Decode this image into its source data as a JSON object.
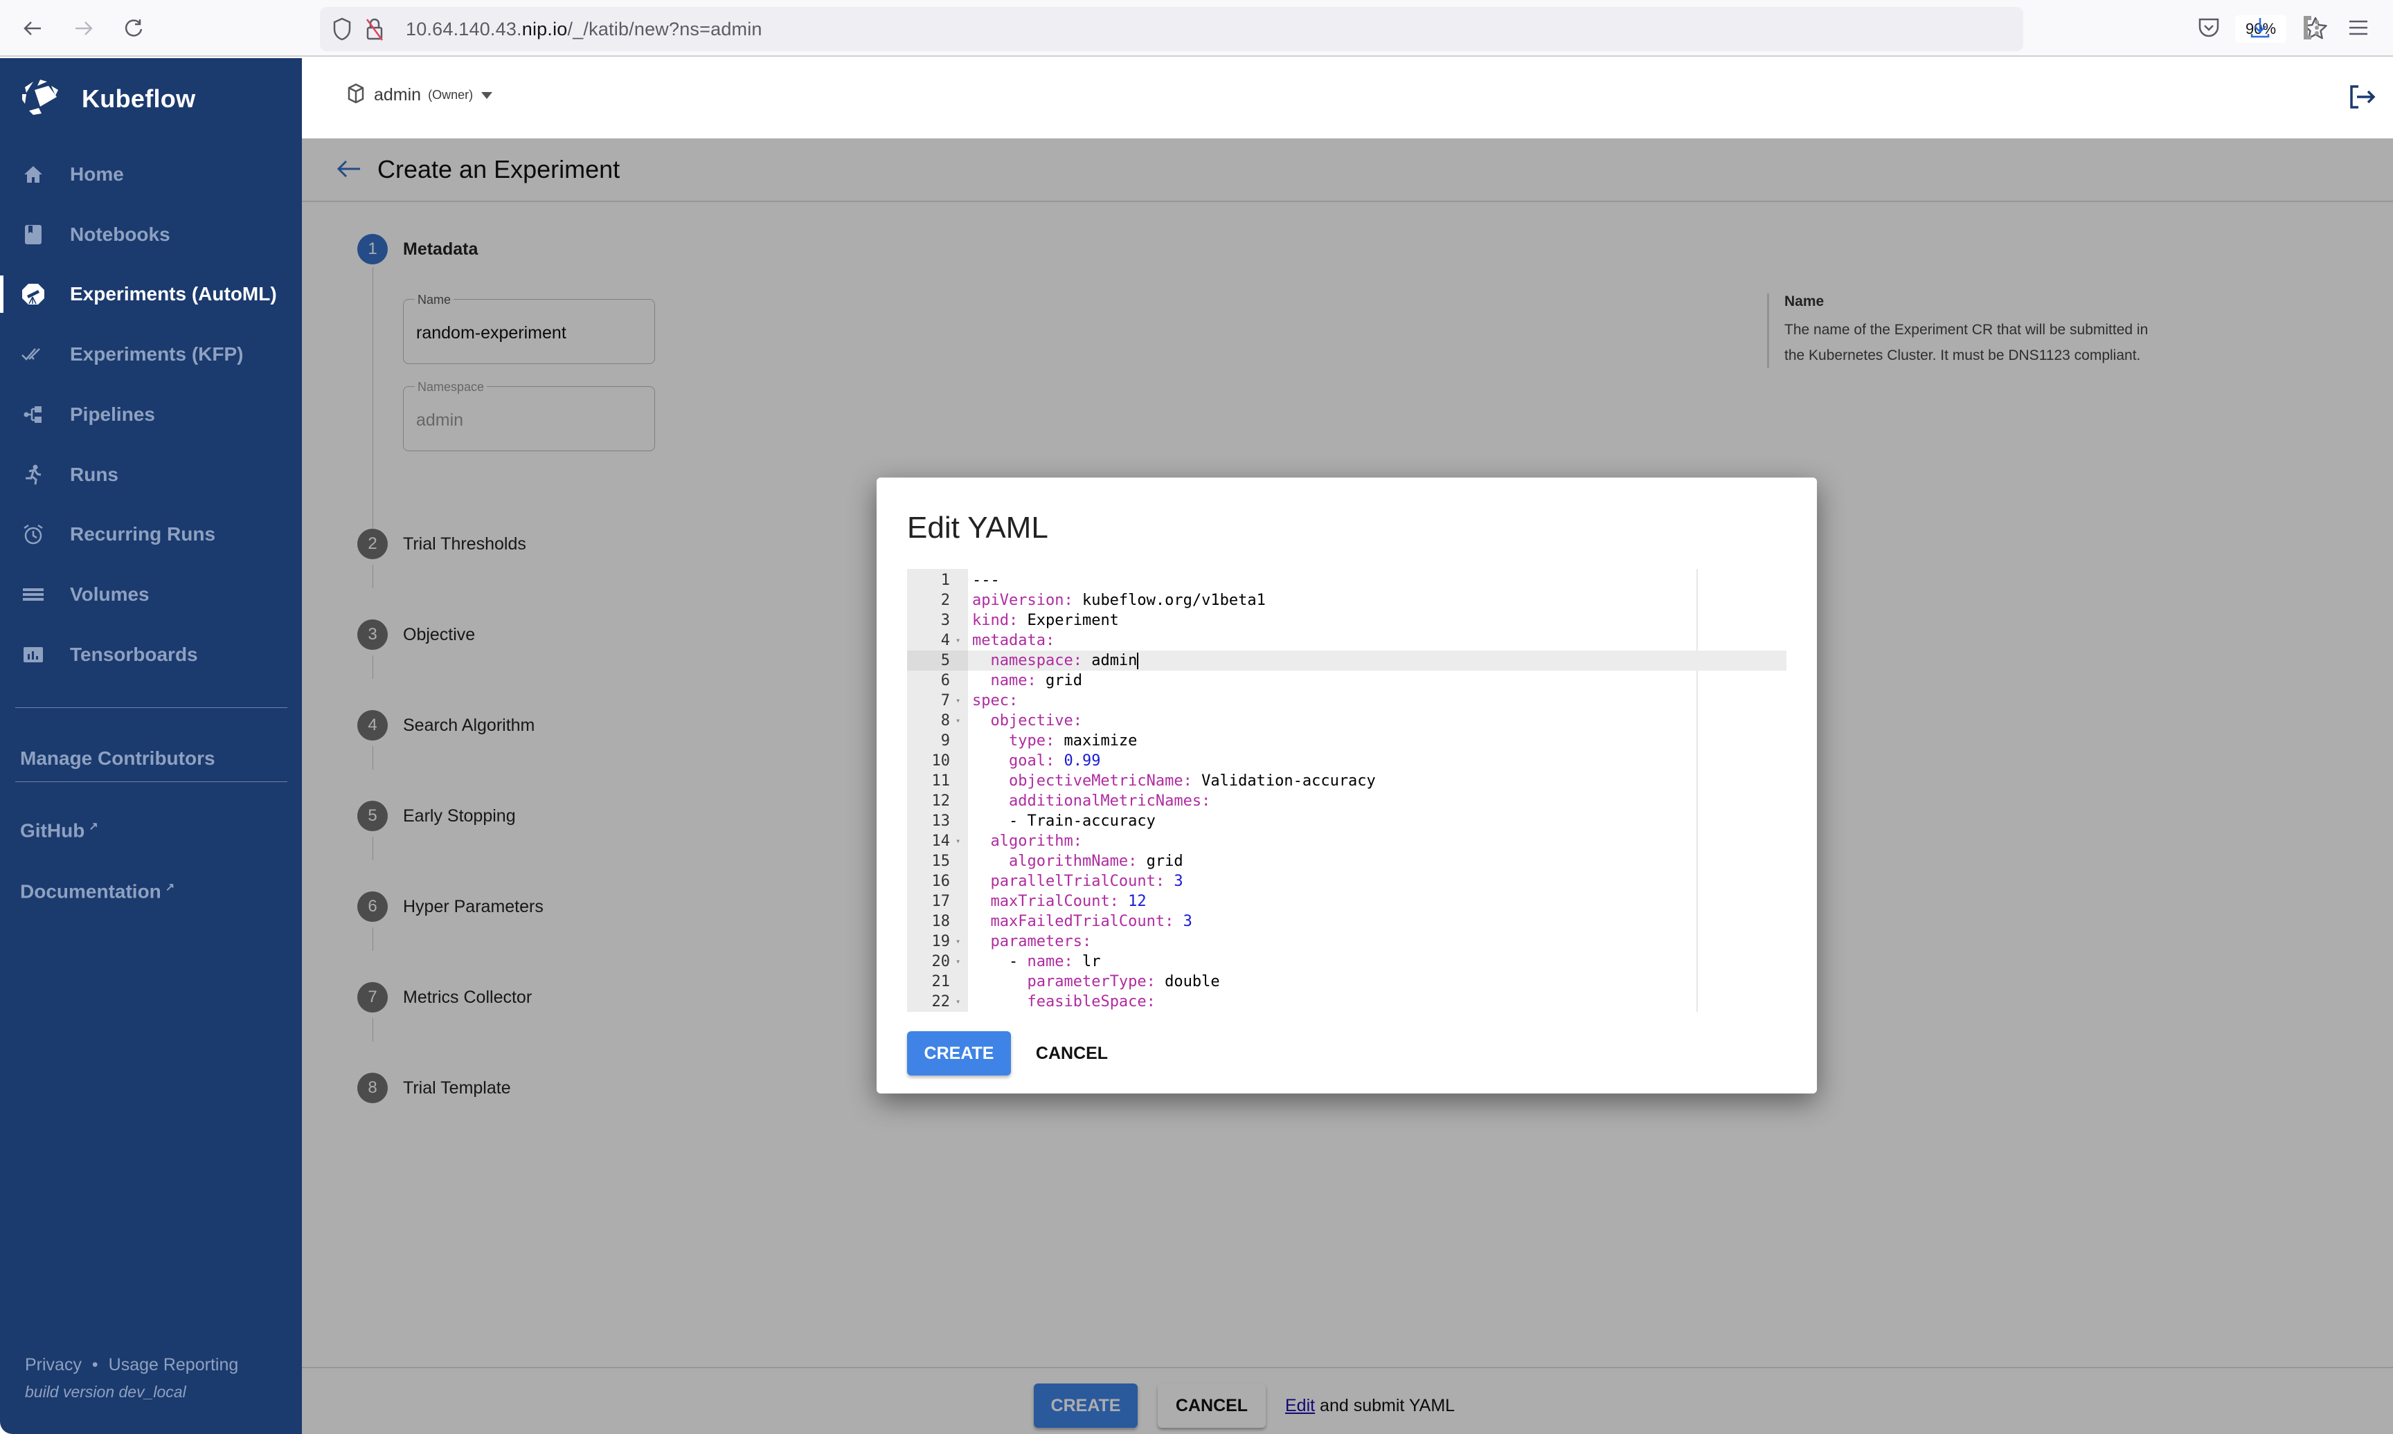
{
  "browser": {
    "url_host": "10.64.140.43.",
    "url_domain": "nip.io",
    "url_path": "/_/katib/new?ns=admin",
    "zoom": "90%"
  },
  "sidebar": {
    "brand": "Kubeflow",
    "items": [
      {
        "label": "Home",
        "icon": "home-icon",
        "active": false
      },
      {
        "label": "Notebooks",
        "icon": "notebook-icon",
        "active": false
      },
      {
        "label": "Experiments (AutoML)",
        "icon": "telescope-icon",
        "active": true
      },
      {
        "label": "Experiments (KFP)",
        "icon": "double-check-icon",
        "active": false
      },
      {
        "label": "Pipelines",
        "icon": "pipeline-icon",
        "active": false
      },
      {
        "label": "Runs",
        "icon": "runner-icon",
        "active": false
      },
      {
        "label": "Recurring Runs",
        "icon": "alarm-icon",
        "active": false
      },
      {
        "label": "Volumes",
        "icon": "storage-icon",
        "active": false
      },
      {
        "label": "Tensorboards",
        "icon": "bar-chart-icon",
        "active": false
      }
    ],
    "manage_contributors": "Manage Contributors",
    "github": "GitHub",
    "documentation": "Documentation",
    "privacy": "Privacy",
    "separator": "•",
    "usage_reporting": "Usage Reporting",
    "build_version": "build version dev_local"
  },
  "header": {
    "namespace": "admin",
    "role": "(Owner)"
  },
  "page": {
    "title": "Create an Experiment",
    "steps": [
      {
        "num": "1",
        "label": "Metadata"
      },
      {
        "num": "2",
        "label": "Trial Thresholds"
      },
      {
        "num": "3",
        "label": "Objective"
      },
      {
        "num": "4",
        "label": "Search Algorithm"
      },
      {
        "num": "5",
        "label": "Early Stopping"
      },
      {
        "num": "6",
        "label": "Hyper Parameters"
      },
      {
        "num": "7",
        "label": "Metrics Collector"
      },
      {
        "num": "8",
        "label": "Trial Template"
      }
    ],
    "name_field": {
      "label": "Name",
      "value": "random-experiment"
    },
    "namespace_field": {
      "label": "Namespace",
      "value": "admin"
    },
    "help": {
      "title": "Name",
      "text": "The name of the Experiment CR that will be submitted in the Kubernetes Cluster. It must be DNS1123 compliant."
    },
    "bottom": {
      "create": "CREATE",
      "cancel": "CANCEL",
      "edit_link": "Edit",
      "edit_suffix": " and submit YAML"
    }
  },
  "dialog": {
    "title": "Edit YAML",
    "create": "CREATE",
    "cancel": "CANCEL",
    "active_line": 5,
    "lines": [
      {
        "n": "1",
        "indent": "",
        "key": "",
        "val": "---",
        "fold": false
      },
      {
        "n": "2",
        "indent": "",
        "key": "apiVersion:",
        "val": " kubeflow.org/v1beta1",
        "fold": false
      },
      {
        "n": "3",
        "indent": "",
        "key": "kind:",
        "val": " Experiment",
        "fold": false
      },
      {
        "n": "4",
        "indent": "",
        "key": "metadata:",
        "val": "",
        "fold": true
      },
      {
        "n": "5",
        "indent": "  ",
        "key": "namespace:",
        "val": " admin",
        "fold": false
      },
      {
        "n": "6",
        "indent": "  ",
        "key": "name:",
        "val": " grid",
        "fold": false
      },
      {
        "n": "7",
        "indent": "",
        "key": "spec:",
        "val": "",
        "fold": true
      },
      {
        "n": "8",
        "indent": "  ",
        "key": "objective:",
        "val": "",
        "fold": true
      },
      {
        "n": "9",
        "indent": "    ",
        "key": "type:",
        "val": " maximize",
        "fold": false
      },
      {
        "n": "10",
        "indent": "    ",
        "key": "goal:",
        "num": " 0.99",
        "fold": false
      },
      {
        "n": "11",
        "indent": "    ",
        "key": "objectiveMetricName:",
        "val": " Validation-accuracy",
        "fold": false
      },
      {
        "n": "12",
        "indent": "    ",
        "key": "additionalMetricNames:",
        "val": "",
        "fold": false
      },
      {
        "n": "13",
        "indent": "    ",
        "key": "",
        "val": "- Train-accuracy",
        "fold": false
      },
      {
        "n": "14",
        "indent": "  ",
        "key": "algorithm:",
        "val": "",
        "fold": true
      },
      {
        "n": "15",
        "indent": "    ",
        "key": "algorithmName:",
        "val": " grid",
        "fold": false
      },
      {
        "n": "16",
        "indent": "  ",
        "key": "parallelTrialCount:",
        "num": " 3",
        "fold": false
      },
      {
        "n": "17",
        "indent": "  ",
        "key": "maxTrialCount:",
        "num": " 12",
        "fold": false
      },
      {
        "n": "18",
        "indent": "  ",
        "key": "maxFailedTrialCount:",
        "num": " 3",
        "fold": false
      },
      {
        "n": "19",
        "indent": "  ",
        "key": "parameters:",
        "val": "",
        "fold": true
      },
      {
        "n": "20",
        "indent": "    ",
        "pre": "- ",
        "key": "name:",
        "val": " lr",
        "fold": true
      },
      {
        "n": "21",
        "indent": "      ",
        "key": "parameterType:",
        "val": " double",
        "fold": false
      },
      {
        "n": "22",
        "indent": "      ",
        "key": "feasibleSpace:",
        "val": "",
        "fold": true
      }
    ]
  },
  "colors": {
    "sidebar_bg": "#1b3a6e",
    "accent": "#3f83e6",
    "yaml_key": "#b02ba0",
    "yaml_number": "#1a1ad6"
  }
}
